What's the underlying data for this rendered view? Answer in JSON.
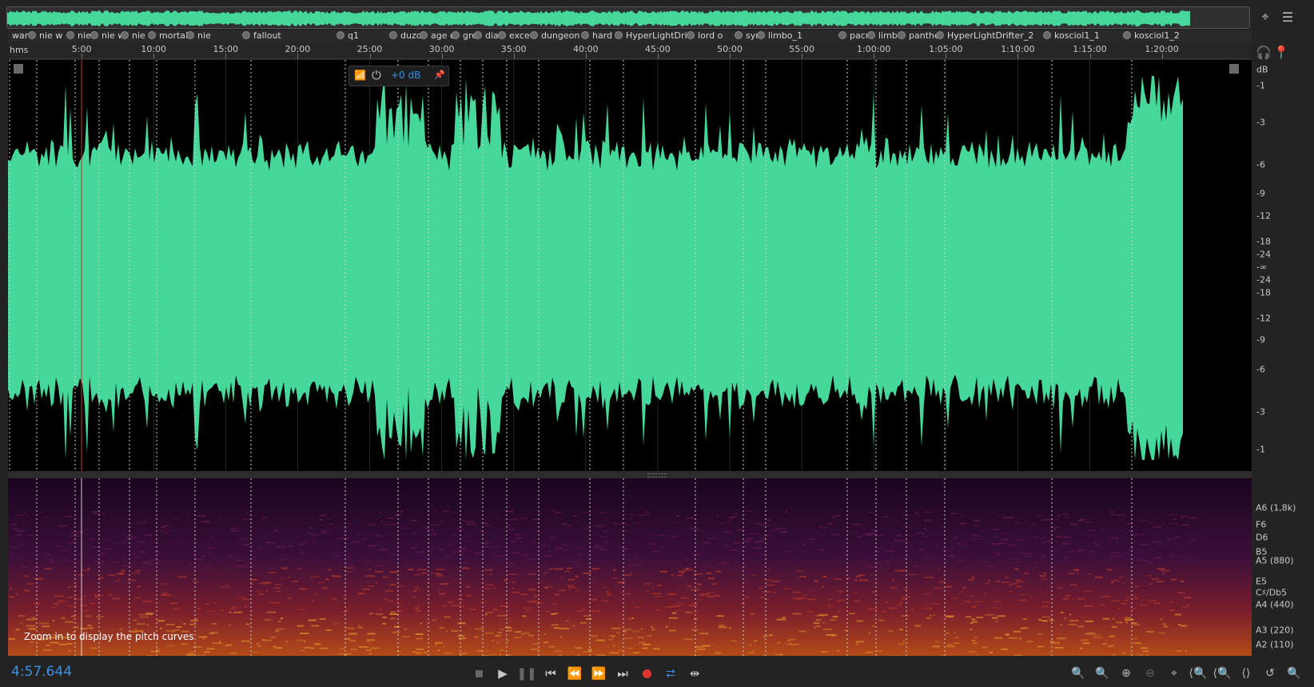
{
  "time_display": "4:57.644",
  "ruler": {
    "unit": "hms",
    "labels": [
      "5:00",
      "10:00",
      "15:00",
      "20:00",
      "25:00",
      "30:00",
      "35:00",
      "40:00",
      "45:00",
      "50:00",
      "55:00",
      "1:00:00",
      "1:05:00",
      "1:10:00",
      "1:15:00",
      "1:20:00"
    ]
  },
  "markers": [
    "warc",
    "nie w",
    "nie",
    "nie w",
    "nie",
    "mortal",
    "nie",
    "fallout",
    "q1",
    "duzo",
    "age o",
    "gre",
    "dia",
    "exce",
    "dungeon k",
    "hard h",
    "HyperLightDrifte",
    "lord o",
    "syn",
    "limbo_1",
    "pacm",
    "limbo",
    "panther",
    "HyperLightDrifter_2",
    "kosciol1_1",
    "kosciol1_2"
  ],
  "hud": {
    "gain": "+0 dB"
  },
  "db_scale": {
    "unit": "dB",
    "labels": [
      "-1",
      "-3",
      "-6",
      "-9",
      "-12",
      "-18",
      "-24",
      "-∞",
      "-24",
      "-18",
      "-12",
      "-9",
      "-6",
      "-3",
      "-1"
    ]
  },
  "pitch_scale": [
    "A6 (1,8k)",
    "F6",
    "D6",
    "B5",
    "A5 (880)",
    "E5",
    "C♯/Db5",
    "A4 (440)",
    "A3 (220)",
    "A2 (110)"
  ],
  "pitch_message": "Zoom in to display the pitch curves",
  "colors": {
    "waveform": "#45d89a",
    "accent": "#3b8ede",
    "record": "#e0342f",
    "playhead": "#c0392b"
  },
  "icons": {
    "top_right": [
      "zoom-to-fit-icon",
      "panel-menu-icon"
    ],
    "ruler_right": [
      "headphones-icon",
      "pin-icon"
    ],
    "transport": [
      "stop-icon",
      "play-icon",
      "pause-icon",
      "go-to-start-icon",
      "rewind-icon",
      "fast-forward-icon",
      "go-to-end-icon",
      "record-icon",
      "loop-icon",
      "skip-selection-icon"
    ],
    "zoom": [
      "zoom-in-amplitude-icon",
      "zoom-out-amplitude-icon",
      "zoom-in-time-icon",
      "zoom-out-time-icon",
      "zoom-full-icon",
      "zoom-selection-icon",
      "zoom-in-left-icon",
      "zoom-in-right-icon",
      "zoom-reset-icon",
      "zoom-history-icon"
    ]
  }
}
